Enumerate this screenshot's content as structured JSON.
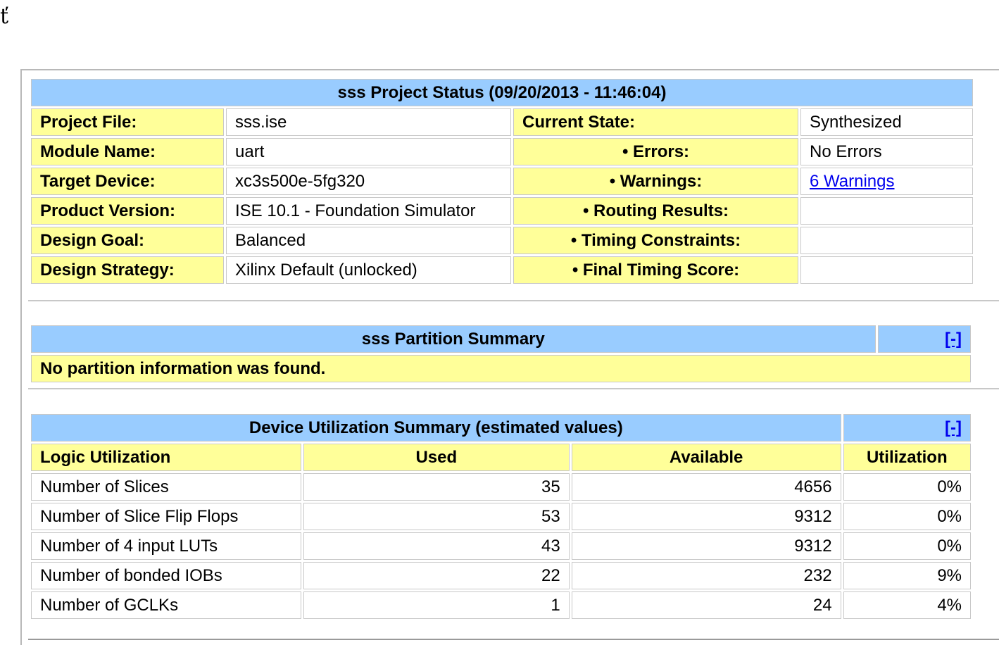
{
  "corner_glyph": "ť",
  "project_status": {
    "title": "sss Project Status (09/20/2013 - 11:46:04)",
    "rows": [
      {
        "label": "Project File:",
        "value": "sss.ise",
        "state_label": "Current State:",
        "state_value": "Synthesized"
      },
      {
        "label": "Module Name:",
        "value": "uart",
        "state_label": "• Errors:",
        "state_value": "No Errors"
      },
      {
        "label": "Target Device:",
        "value": "xc3s500e-5fg320",
        "state_label": "• Warnings:",
        "state_value": "6 Warnings"
      },
      {
        "label": "Product Version:",
        "value": "ISE 10.1 - Foundation Simulator",
        "state_label": "• Routing Results:",
        "state_value": ""
      },
      {
        "label": "Design Goal:",
        "value": "Balanced",
        "state_label": "• Timing Constraints:",
        "state_value": ""
      },
      {
        "label": "Design Strategy:",
        "value": "Xilinx Default (unlocked)",
        "state_label": "• Final Timing Score:",
        "state_value": ""
      }
    ]
  },
  "partition_summary": {
    "title": "sss Partition Summary",
    "toggle": "[-]",
    "message": "No partition information was found."
  },
  "device_utilization": {
    "title": "Device Utilization Summary (estimated values)",
    "toggle": "[-]",
    "columns": [
      "Logic Utilization",
      "Used",
      "Available",
      "Utilization"
    ],
    "rows": [
      {
        "name": "Number of Slices",
        "used": "35",
        "available": "4656",
        "utilization": "0%"
      },
      {
        "name": "Number of Slice Flip Flops",
        "used": "53",
        "available": "9312",
        "utilization": "0%"
      },
      {
        "name": "Number of 4 input LUTs",
        "used": "43",
        "available": "9312",
        "utilization": "0%"
      },
      {
        "name": "Number of bonded IOBs",
        "used": "22",
        "available": "232",
        "utilization": "9%"
      },
      {
        "name": "Number of GCLKs",
        "used": "1",
        "available": "24",
        "utilization": "4%"
      }
    ]
  },
  "colors": {
    "header_bg": "#99ccff",
    "label_bg": "#ffff99",
    "link": "#0000ee"
  }
}
